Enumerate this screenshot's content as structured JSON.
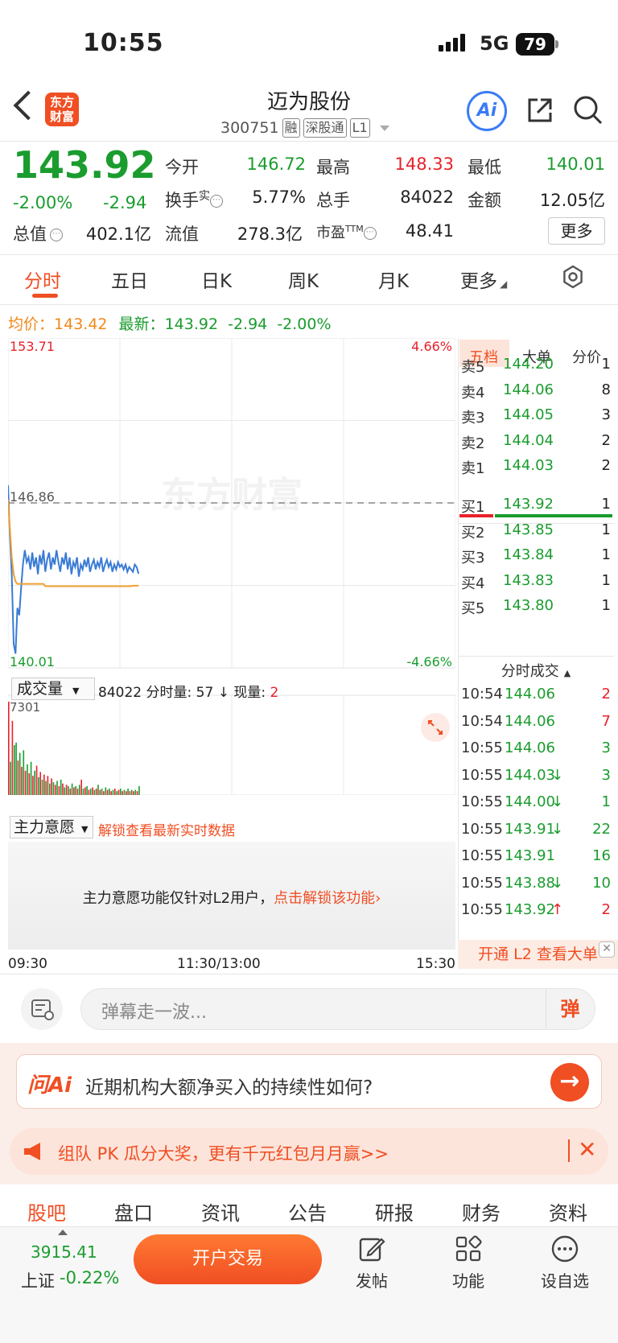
{
  "status": {
    "time": "10:55",
    "network": "5G",
    "battery": "79"
  },
  "header": {
    "title": "迈为股份",
    "code": "300751",
    "tags": [
      "融",
      "深股通",
      "L1"
    ],
    "logo_line1": "东方",
    "logo_line2": "财富",
    "ai_label": "Ai"
  },
  "quote": {
    "price": "143.92",
    "pct": "-2.00%",
    "change": "-2.94",
    "fields": {
      "open_label": "今开",
      "open": "146.72",
      "high_label": "最高",
      "high": "148.33",
      "low_label": "最低",
      "low": "140.01",
      "turnover_label": "换手",
      "turnover_sup": "实",
      "turnover": "5.77%",
      "volume_label": "总手",
      "volume": "84022",
      "amount_label": "金额",
      "amount": "12.05亿",
      "mktcap_label": "总值",
      "mktcap": "402.1亿",
      "float_label": "流值",
      "float": "278.3亿",
      "pe_label": "市盈",
      "pe_sup": "TTM",
      "pe": "48.41"
    },
    "more_label": "更多"
  },
  "tabs": [
    "分时",
    "五日",
    "日K",
    "周K",
    "月K",
    "更多"
  ],
  "active_tab": "分时",
  "avg": {
    "avg_label": "均价：",
    "avg_value": "143.42",
    "latest_label": "最新：",
    "latest_value": "143.92",
    "change": "-2.94",
    "pct": "-2.00%"
  },
  "chart_data": {
    "type": "line",
    "title": "",
    "y_top_label": "153.71",
    "y_bottom_label": "140.01",
    "y_ref_label": "146.86",
    "pct_top_label": "4.66%",
    "pct_bottom_label": "-4.66%",
    "ylim": [
      140.01,
      153.71
    ],
    "ref_price": 146.86,
    "watermark": "东方财富",
    "x_labels": [
      "09:30",
      "11:30/13:00",
      "15:30"
    ],
    "total_minutes": 240,
    "series": [
      {
        "color": "#3a7bd5",
        "values": [
          147.6,
          145.5,
          143.9,
          141.0,
          140.6,
          142.5,
          142.2,
          143.3,
          144.3,
          144.9,
          144.4,
          144.6,
          144.1,
          144.8,
          144.2,
          144.6,
          143.9,
          144.7,
          144.3,
          144.9,
          144.0,
          144.5,
          144.8,
          144.1,
          144.6,
          144.3,
          144.9,
          144.4,
          144.0,
          144.6,
          144.3,
          144.8,
          144.1,
          144.6,
          143.9,
          144.4,
          144.2,
          144.6,
          143.8,
          144.3,
          144.1,
          144.5,
          144.2,
          144.6,
          144.0,
          144.3,
          144.5,
          144.1,
          144.4,
          144.2,
          144.6,
          144.0,
          144.3,
          144.5,
          144.2,
          144.4,
          144.0,
          144.3,
          144.1,
          144.4,
          144.2,
          144.3,
          144.1,
          144.3,
          144.0,
          144.2,
          144.1,
          144.0,
          144.3,
          144.2,
          143.92
        ]
      },
      {
        "color": "#f0a030",
        "values": [
          147.0,
          145.8,
          144.6,
          143.9,
          143.6,
          143.5,
          143.5,
          143.5,
          143.5,
          143.5,
          143.5,
          143.5,
          143.5,
          143.5,
          143.5,
          143.5,
          143.5,
          143.5,
          143.5,
          143.5,
          143.4,
          143.4,
          143.4,
          143.4,
          143.4,
          143.4,
          143.4,
          143.4,
          143.4,
          143.4,
          143.4,
          143.4,
          143.4,
          143.4,
          143.4,
          143.4,
          143.4,
          143.4,
          143.4,
          143.4,
          143.4,
          143.4,
          143.4,
          143.4,
          143.4,
          143.4,
          143.4,
          143.4,
          143.4,
          143.4,
          143.4,
          143.4,
          143.4,
          143.4,
          143.4,
          143.4,
          143.4,
          143.4,
          143.4,
          143.4,
          143.4,
          143.4,
          143.4,
          143.4,
          143.4,
          143.4,
          143.4,
          143.42,
          143.42,
          143.42,
          143.42
        ]
      }
    ],
    "volume": {
      "max_label": "7301",
      "ylim": [
        0,
        7301
      ],
      "values": [
        7301,
        2600,
        5800,
        3900,
        4100,
        2700,
        3300,
        2200,
        3500,
        1900,
        2400,
        1700,
        2600,
        1500,
        1900,
        2300,
        1400,
        1800,
        1200,
        1600,
        1100,
        1500,
        900,
        1300,
        1000,
        800,
        1100,
        700,
        1200,
        900,
        600,
        800,
        700,
        500,
        900,
        600,
        700,
        500,
        800,
        1200,
        500,
        600,
        700,
        400,
        500,
        600,
        400,
        500,
        800,
        400,
        500,
        300,
        600,
        400,
        500,
        300,
        400,
        500,
        300,
        400,
        500,
        300,
        400,
        300,
        500,
        300,
        400,
        300,
        400,
        300,
        700
      ],
      "colors": [
        "r",
        "g",
        "r",
        "g",
        "g",
        "r",
        "g",
        "r",
        "g",
        "r",
        "g",
        "r",
        "g",
        "r",
        "g",
        "r",
        "g",
        "r",
        "g",
        "r",
        "g",
        "r",
        "g",
        "r",
        "g",
        "r",
        "g",
        "r",
        "g",
        "r",
        "g",
        "r",
        "g",
        "r",
        "g",
        "r",
        "g",
        "r",
        "g",
        "r",
        "g",
        "r",
        "g",
        "r",
        "g",
        "r",
        "g",
        "r",
        "g",
        "r",
        "g",
        "r",
        "g",
        "r",
        "g",
        "r",
        "g",
        "r",
        "g",
        "r",
        "g",
        "r",
        "g",
        "r",
        "g",
        "r",
        "g",
        "r",
        "g",
        "r",
        "g"
      ]
    }
  },
  "volume_panel": {
    "select_label": "成交量",
    "total": "84022",
    "min_label": "分时量:",
    "min_value": "57",
    "arrow": "↓",
    "cur_label": "现量:",
    "cur_value": "2"
  },
  "main_force": {
    "select_label": "主力意愿",
    "unlock_text": "解锁查看最新实时数据",
    "message": "主力意愿功能仅针对L2用户，",
    "link": "点击解锁该功能",
    "link_arrow": "›"
  },
  "orderbook": {
    "tabs": [
      "五档",
      "大单",
      "分价"
    ],
    "asks": [
      {
        "label": "卖5",
        "price": "144.20",
        "vol": "1"
      },
      {
        "label": "卖4",
        "price": "144.06",
        "vol": "8"
      },
      {
        "label": "卖3",
        "price": "144.05",
        "vol": "3"
      },
      {
        "label": "卖2",
        "price": "144.04",
        "vol": "2"
      },
      {
        "label": "卖1",
        "price": "144.03",
        "vol": "2"
      }
    ],
    "bids": [
      {
        "label": "买1",
        "price": "143.92",
        "vol": "1"
      },
      {
        "label": "买2",
        "price": "143.85",
        "vol": "1"
      },
      {
        "label": "买3",
        "price": "143.84",
        "vol": "1"
      },
      {
        "label": "买4",
        "price": "143.83",
        "vol": "1"
      },
      {
        "label": "买5",
        "price": "143.80",
        "vol": "1"
      }
    ],
    "ratio_buy_fraction": 0.22,
    "ticks_title": "分时成交",
    "ticks": [
      {
        "time": "10:54",
        "price": "144.06",
        "dir": "",
        "vol": "2",
        "vol_color": "red"
      },
      {
        "time": "10:54",
        "price": "144.06",
        "dir": "",
        "vol": "7",
        "vol_color": "red"
      },
      {
        "time": "10:55",
        "price": "144.06",
        "dir": "",
        "vol": "3",
        "vol_color": "green"
      },
      {
        "time": "10:55",
        "price": "144.03",
        "dir": "↓",
        "vol": "3",
        "vol_color": "green"
      },
      {
        "time": "10:55",
        "price": "144.00",
        "dir": "↓",
        "vol": "1",
        "vol_color": "green"
      },
      {
        "time": "10:55",
        "price": "143.91",
        "dir": "↓",
        "vol": "22",
        "vol_color": "green"
      },
      {
        "time": "10:55",
        "price": "143.91",
        "dir": "",
        "vol": "16",
        "vol_color": "green"
      },
      {
        "time": "10:55",
        "price": "143.88",
        "dir": "↓",
        "vol": "10",
        "vol_color": "green"
      },
      {
        "time": "10:55",
        "price": "143.92",
        "dir": "↑",
        "vol": "2",
        "vol_color": "red"
      }
    ],
    "l2_label": "开通 L2 查看大单"
  },
  "danmaku": {
    "placeholder": "弹幕走一波...",
    "button": "弹"
  },
  "ask_ai": {
    "logo": "问Ai",
    "question": "近期机构大额净买入的持续性如何?",
    "arrow": "→"
  },
  "promo": {
    "text": "组队 PK 瓜分大奖，更有千元红包月月赢>>",
    "close": "✕"
  },
  "bottom_tabs": [
    "股吧",
    "盘口",
    "资讯",
    "公告",
    "研报",
    "财务",
    "资料"
  ],
  "bottom_bar": {
    "index_value": "3915.41",
    "index_name": "上证",
    "index_pct": "-0.22%",
    "trade_label": "开户交易",
    "post_label": "发帖",
    "func_label": "功能",
    "watch_label": "设自选"
  }
}
